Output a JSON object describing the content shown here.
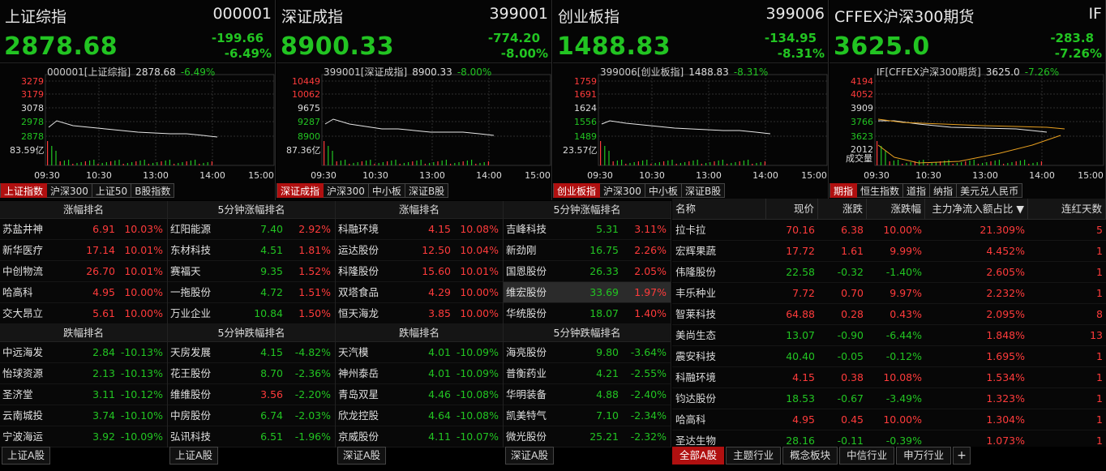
{
  "indices": [
    {
      "name": "上证综指",
      "code": "000001",
      "price": "2878.68",
      "change": "-199.66",
      "pct": "-6.49%",
      "chart_title": "000001[上证综指]",
      "chart_price": "2878.68",
      "chart_pct": "-6.49%",
      "yticks": [
        "3279",
        "3179",
        "3078",
        "2978",
        "2878"
      ],
      "volume": "83.59亿",
      "xticks": [
        "09:30",
        "10:30",
        "13:00",
        "14:00",
        "15:00"
      ],
      "tabs": [
        "上证指数",
        "沪深300",
        "上证50",
        "B股指数"
      ]
    },
    {
      "name": "深证成指",
      "code": "399001",
      "price": "8900.33",
      "change": "-774.20",
      "pct": "-8.00%",
      "chart_title": "399001[深证成指]",
      "chart_price": "8900.33",
      "chart_pct": "-8.00%",
      "yticks": [
        "10449",
        "10062",
        "9675",
        "9287",
        "8900"
      ],
      "volume": "87.36亿",
      "xticks": [
        "09:30",
        "10:30",
        "13:00",
        "14:00",
        "15:00"
      ],
      "tabs": [
        "深证成指",
        "沪深300",
        "中小板",
        "深证B股"
      ]
    },
    {
      "name": "创业板指",
      "code": "399006",
      "price": "1488.83",
      "change": "-134.95",
      "pct": "-8.31%",
      "chart_title": "399006[创业板指]",
      "chart_price": "1488.83",
      "chart_pct": "-8.31%",
      "yticks": [
        "1759",
        "1691",
        "1624",
        "1556",
        "1489"
      ],
      "volume": "23.57亿",
      "xticks": [
        "09:30",
        "10:30",
        "13:00",
        "14:00",
        "15:00"
      ],
      "tabs": [
        "创业板指",
        "沪深300",
        "中小板",
        "深证B股"
      ]
    },
    {
      "name": "CFFEX沪深300期货",
      "code": "IF",
      "price": "3625.0",
      "change": "-283.8",
      "pct": "-7.26%",
      "chart_title": "IF[CFFEX沪深300期货]",
      "chart_price": "3625.0",
      "chart_pct": "-7.26%",
      "yticks": [
        "4194",
        "4052",
        "3909",
        "3766",
        "3623"
      ],
      "volume": "成交量",
      "vol_tick": "2012",
      "xticks": [
        "09:30",
        "10:30",
        "13:00",
        "14:00",
        "15:00"
      ],
      "tabs": [
        "期指",
        "恒生指数",
        "道指",
        "纳指",
        "美元兑人民币"
      ]
    }
  ],
  "ranks": {
    "sh_up": {
      "title": "涨幅排名",
      "rows": [
        [
          "苏盐井神",
          "6.91",
          "10.03%"
        ],
        [
          "新华医疗",
          "17.14",
          "10.01%"
        ],
        [
          "中创物流",
          "26.70",
          "10.01%"
        ],
        [
          "哈高科",
          "4.95",
          "10.00%"
        ],
        [
          "交大昂立",
          "5.61",
          "10.00%"
        ]
      ]
    },
    "sh_5up": {
      "title": "5分钟涨幅排名",
      "rows": [
        [
          "红阳能源",
          "7.40",
          "2.92%"
        ],
        [
          "东材科技",
          "4.51",
          "1.81%"
        ],
        [
          "赛福天",
          "9.35",
          "1.52%"
        ],
        [
          "一拖股份",
          "4.72",
          "1.51%"
        ],
        [
          "万业企业",
          "10.84",
          "1.50%"
        ]
      ]
    },
    "sz_up": {
      "title": "涨幅排名",
      "rows": [
        [
          "科融环境",
          "4.15",
          "10.08%"
        ],
        [
          "运达股份",
          "12.50",
          "10.04%"
        ],
        [
          "科隆股份",
          "15.60",
          "10.01%"
        ],
        [
          "双塔食品",
          "4.29",
          "10.00%"
        ],
        [
          "恒天海龙",
          "3.85",
          "10.00%"
        ]
      ]
    },
    "sz_5up": {
      "title": "5分钟涨幅排名",
      "rows": [
        [
          "吉峰科技",
          "5.31",
          "3.11%"
        ],
        [
          "新劲刚",
          "16.75",
          "2.26%"
        ],
        [
          "国恩股份",
          "26.33",
          "2.05%"
        ],
        [
          "维宏股份",
          "33.69",
          "1.97%"
        ],
        [
          "华统股份",
          "18.07",
          "1.40%"
        ]
      ]
    },
    "sh_down": {
      "title": "跌幅排名",
      "rows": [
        [
          "中远海发",
          "2.84",
          "-10.13%"
        ],
        [
          "怡球资源",
          "2.13",
          "-10.13%"
        ],
        [
          "圣济堂",
          "3.11",
          "-10.12%"
        ],
        [
          "云南城投",
          "3.74",
          "-10.10%"
        ],
        [
          "宁波海运",
          "3.92",
          "-10.09%"
        ]
      ]
    },
    "sh_5down": {
      "title": "5分钟跌幅排名",
      "rows": [
        [
          "天房发展",
          "4.15",
          "-4.82%"
        ],
        [
          "花王股份",
          "8.70",
          "-2.36%"
        ],
        [
          "维维股份",
          "3.56",
          "-2.20%"
        ],
        [
          "中房股份",
          "6.74",
          "-2.03%"
        ],
        [
          "弘讯科技",
          "6.51",
          "-1.96%"
        ]
      ]
    },
    "sz_down": {
      "title": "跌幅排名",
      "rows": [
        [
          "天汽模",
          "4.01",
          "-10.09%"
        ],
        [
          "神州泰岳",
          "4.01",
          "-10.09%"
        ],
        [
          "青岛双星",
          "4.46",
          "-10.08%"
        ],
        [
          "欣龙控股",
          "4.64",
          "-10.08%"
        ],
        [
          "京威股份",
          "4.11",
          "-10.07%"
        ]
      ]
    },
    "sz_5down": {
      "title": "5分钟跌幅排名",
      "rows": [
        [
          "海亮股份",
          "9.80",
          "-3.64%"
        ],
        [
          "普衡药业",
          "4.21",
          "-2.55%"
        ],
        [
          "华明装备",
          "4.88",
          "-2.40%"
        ],
        [
          "凯美特气",
          "7.10",
          "-2.34%"
        ],
        [
          "微光股份",
          "25.21",
          "-2.32%"
        ]
      ]
    }
  },
  "bottom_tabs": [
    "上证A股",
    "上证A股",
    "深证A股",
    "深证A股"
  ],
  "flow": {
    "headers": [
      "名称",
      "现价",
      "涨跌",
      "涨跌幅",
      "主力净流入额占比 ▼",
      "连红天数"
    ],
    "rows": [
      [
        "拉卡拉",
        "70.16",
        "6.38",
        "10.00%",
        "21.309%",
        "5"
      ],
      [
        "宏辉果蔬",
        "17.72",
        "1.61",
        "9.99%",
        "4.452%",
        "1"
      ],
      [
        "伟隆股份",
        "22.58",
        "-0.32",
        "-1.40%",
        "2.605%",
        "1"
      ],
      [
        "丰乐种业",
        "7.72",
        "0.70",
        "9.97%",
        "2.232%",
        "1"
      ],
      [
        "智莱科技",
        "64.88",
        "0.28",
        "0.43%",
        "2.095%",
        "8"
      ],
      [
        "美尚生态",
        "13.07",
        "-0.90",
        "-6.44%",
        "1.848%",
        "13"
      ],
      [
        "震安科技",
        "40.40",
        "-0.05",
        "-0.12%",
        "1.695%",
        "1"
      ],
      [
        "科融环境",
        "4.15",
        "0.38",
        "10.08%",
        "1.534%",
        "1"
      ],
      [
        "钧达股份",
        "18.53",
        "-0.67",
        "-3.49%",
        "1.323%",
        "1"
      ],
      [
        "哈高科",
        "4.95",
        "0.45",
        "10.00%",
        "1.304%",
        "1"
      ],
      [
        "圣达生物",
        "28.16",
        "-0.11",
        "-0.39%",
        "1.073%",
        "1"
      ]
    ],
    "tabs": [
      "全部A股",
      "主题行业",
      "概念板块",
      "中信行业",
      "申万行业",
      "+"
    ]
  },
  "colors": {
    "up": "#ff3b3b",
    "down": "#22c422",
    "active_tab": "#b01010"
  }
}
